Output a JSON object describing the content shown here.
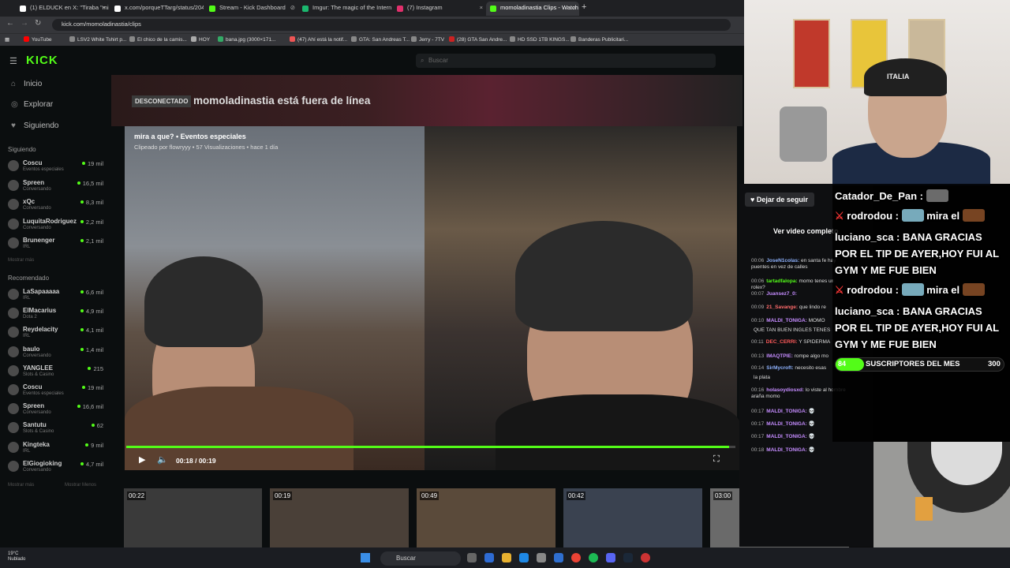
{
  "browser": {
    "tabs": [
      {
        "label": "(1) ELDUCK en X: \"Tiraba \"mirá",
        "color": "#ffffff"
      },
      {
        "label": "x.com/porqueTTarg/status/204",
        "color": "#ffffff"
      },
      {
        "label": "Stream - Kick Dashboard",
        "color": "#53fc18"
      },
      {
        "label": "Imgur: The magic of the Intern",
        "color": "#1bb76e"
      },
      {
        "label": "(7) Instagram",
        "color": "#e1306c"
      },
      {
        "label": "momoladinastia Clips - Watch",
        "color": "#53fc18"
      }
    ],
    "url": "kick.com/momoladinastia/clips",
    "bookmarks": [
      "YouTube",
      "LSV2 White Tshirt p...",
      "El chico de la camis...",
      "HOY",
      "bana.jpg (3000×171...",
      "(47) Ahí está la notif...",
      "GTA: San Andreas T...",
      "Jerry - 7TV",
      "(28) GTA San Andre...",
      "HD SSD 1TB KINGS...",
      "Banderas Publicitari..."
    ]
  },
  "kick": {
    "logo": "KICK",
    "search_placeholder": "Buscar",
    "nav": [
      "Inicio",
      "Explorar",
      "Siguiendo"
    ],
    "following_header": "Siguiendo",
    "following": [
      {
        "name": "Coscu",
        "sub": "Eventos especiales",
        "viewers": "19 mil"
      },
      {
        "name": "Spreen",
        "sub": "Conversando",
        "viewers": "16,5 mil"
      },
      {
        "name": "xQc",
        "sub": "Conversando",
        "viewers": "8,3 mil"
      },
      {
        "name": "LuquitaRodriguez",
        "sub": "Conversando",
        "viewers": "2,2 mil"
      },
      {
        "name": "Brunenger",
        "sub": "IRL",
        "viewers": "2,1 mil"
      }
    ],
    "show_more": "Mostrar más",
    "recommended_header": "Recomendado",
    "recommended": [
      {
        "name": "LaSapaaaaa",
        "sub": "IRL",
        "viewers": "6,6 mil"
      },
      {
        "name": "ElMacarius",
        "sub": "Dota 2",
        "viewers": "4,9 mil"
      },
      {
        "name": "Reydelacity",
        "sub": "IRL",
        "viewers": "4,1 mil"
      },
      {
        "name": "baulo",
        "sub": "Conversando",
        "viewers": "1,4 mil"
      },
      {
        "name": "YANGLEE",
        "sub": "Slots & Casino",
        "viewers": "215"
      },
      {
        "name": "Coscu",
        "sub": "Eventos especiales",
        "viewers": "19 mil"
      },
      {
        "name": "Spreen",
        "sub": "Conversando",
        "viewers": "16,6 mil"
      },
      {
        "name": "Santutu",
        "sub": "Slots & Casino",
        "viewers": "62"
      },
      {
        "name": "Kingteka",
        "sub": "IRL",
        "viewers": "9 mil"
      },
      {
        "name": "ElGiogioking",
        "sub": "Conversando",
        "viewers": "4,7 mil"
      }
    ],
    "show_more_bottom": "Mostrar más",
    "show_less": "Mostrar Menos",
    "offline_badge": "DESCONECTADO",
    "offline_text": "momoladinastia está fuera de línea",
    "clip_title": "mira a que? • Eventos especiales",
    "clip_meta": "Clipeado por flowryyy • 57 Visualizaciones • hace 1 día",
    "time": "00:18 / 00:19",
    "progress": 0.99,
    "thumbs": [
      "00:22",
      "00:19",
      "00:49",
      "00:42",
      "03:00"
    ],
    "follow_button": "Dejar de seguir",
    "full_video": "Ver video completo"
  },
  "chat": [
    {
      "t": "00:06",
      "u": "JoseN1colas:",
      "m": "en santa fe hay puentes en vez de calles",
      "c": "#8fb3ff"
    },
    {
      "t": "00:06",
      "u": "tartadfalopa:",
      "m": "momo tenes un rolex?",
      "c": "#53fc18"
    },
    {
      "t": "00:07",
      "u": "Juansez7_0:",
      "m": "",
      "c": "#c58cff"
    },
    {
      "t": "00:09",
      "u": "21_Savange:",
      "m": "que lindo re",
      "c": "#ff6b6b"
    },
    {
      "t": "00:10",
      "u": "MALDI_TONIGA:",
      "m": "MOMO",
      "c": "#c58cff"
    },
    {
      "t": "",
      "u": "",
      "m": "QUE TAN BUEN INGLES TENES",
      "c": "#ddd"
    },
    {
      "t": "00:11",
      "u": "DEC_CERRI:",
      "m": "Y SPIDERMA",
      "c": "#ff5a5a"
    },
    {
      "t": "00:13",
      "u": "IMAQTPIE:",
      "m": "rompe algo mo",
      "c": "#c58cff"
    },
    {
      "t": "00:14",
      "u": "SirMycroft:",
      "m": "necesito esas",
      "c": "#8fb3ff"
    },
    {
      "t": "",
      "u": "",
      "m": "la plata",
      "c": "#ddd"
    },
    {
      "t": "00:16",
      "u": "holasoydiosxd:",
      "m": "lo viste al hombre araña momo",
      "c": "#c58cff"
    },
    {
      "t": "00:17",
      "u": "MALDI_TONIGA:",
      "m": "💀",
      "c": "#c58cff"
    },
    {
      "t": "00:17",
      "u": "MALDI_TONIGA:",
      "m": "💀",
      "c": "#c58cff"
    },
    {
      "t": "00:17",
      "u": "MALDI_TONIGA:",
      "m": "💀",
      "c": "#c58cff"
    },
    {
      "t": "00:18",
      "u": "MALDI_TONIGA:",
      "m": "💀",
      "c": "#c58cff"
    }
  ],
  "overlay": {
    "lines": [
      {
        "user": "Catador_De_Pan",
        "msg": ""
      },
      {
        "user": "rodrodou",
        "msg": "mira el"
      },
      {
        "user": "luciano_sca",
        "msg": "BANA GRACIAS POR EL TIP DE AYER,HOY FUI AL GYM Y ME FUE BIEN"
      },
      {
        "user": "rodrodou",
        "msg": "mira el"
      },
      {
        "user": "luciano_sca",
        "msg": "BANA GRACIAS POR EL TIP DE AYER,HOY FUI AL GYM Y ME FUE BIEN"
      }
    ],
    "subs_current": "84",
    "subs_label": "SUSCRIPTORES DEL MES",
    "subs_goal": "300",
    "subs_fraction": 0.28
  },
  "webcam": {
    "cap_text": "ITALIA"
  },
  "taskbar": {
    "temp": "19°C",
    "weather": "Nublado",
    "search": "Buscar"
  }
}
